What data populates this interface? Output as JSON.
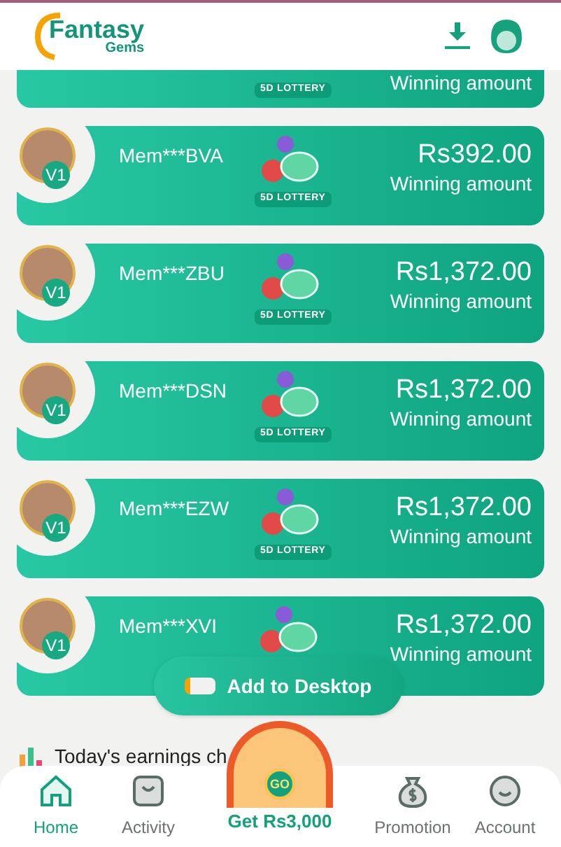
{
  "header": {
    "logo_title": "Fantasy",
    "logo_subtitle": "Gems"
  },
  "winners": [
    {
      "game": "5D LOTTERY",
      "caption": "Winning amount",
      "partial": true
    },
    {
      "name": "Mem***BVA",
      "game": "5D LOTTERY",
      "amount": "Rs392.00",
      "caption": "Winning amount",
      "level": "V1",
      "partial": false
    },
    {
      "name": "Mem***ZBU",
      "game": "5D LOTTERY",
      "amount": "Rs1,372.00",
      "caption": "Winning amount",
      "level": "V1",
      "partial": false
    },
    {
      "name": "Mem***DSN",
      "game": "5D LOTTERY",
      "amount": "Rs1,372.00",
      "caption": "Winning amount",
      "level": "V1",
      "partial": false
    },
    {
      "name": "Mem***EZW",
      "game": "5D LOTTERY",
      "amount": "Rs1,372.00",
      "caption": "Winning amount",
      "level": "V1",
      "partial": false
    },
    {
      "name": "Mem***XVI",
      "amount": "Rs1,372.00",
      "caption": "Winning amount",
      "level": "V1",
      "partial": false
    }
  ],
  "add_to_desktop": {
    "label": "Add to Desktop"
  },
  "section_title": "Today's earnings ch",
  "bonus_wheel": {
    "button": "GO",
    "label": "Get Rs3,000"
  },
  "nav": [
    {
      "label": "Home",
      "selected": true
    },
    {
      "label": "Activity",
      "selected": false
    },
    {
      "label": "Promotion",
      "selected": false
    },
    {
      "label": "Account",
      "selected": false
    }
  ]
}
